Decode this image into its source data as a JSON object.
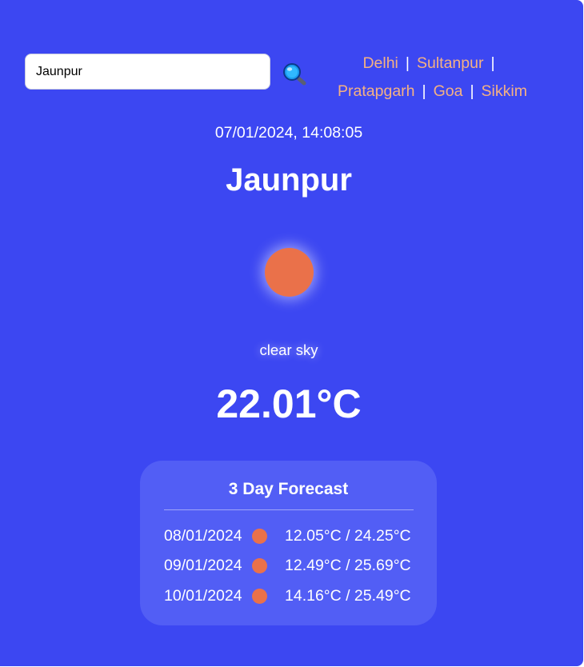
{
  "search": {
    "value": "Jaunpur",
    "button_icon": "magnifier-icon"
  },
  "cities": [
    "Delhi",
    "Sultanpur",
    "Pratapgarh",
    "Goa",
    "Sikkim"
  ],
  "current": {
    "datetime": "07/01/2024, 14:08:05",
    "city": "Jaunpur",
    "icon": "sun-icon",
    "description": "clear sky",
    "temperature": "22.01°C"
  },
  "forecast": {
    "title": "3 Day Forecast",
    "days": [
      {
        "date": "08/01/2024",
        "icon": "sun-icon",
        "temps": "12.05°C / 24.25°C"
      },
      {
        "date": "09/01/2024",
        "icon": "sun-icon",
        "temps": "12.49°C / 25.69°C"
      },
      {
        "date": "10/01/2024",
        "icon": "sun-icon",
        "temps": "14.16°C / 25.49°C"
      }
    ]
  },
  "colors": {
    "background": "#3c47f2",
    "forecast_panel": "#525ef5",
    "city_link": "#f4b183",
    "sun": "#ea714a"
  }
}
